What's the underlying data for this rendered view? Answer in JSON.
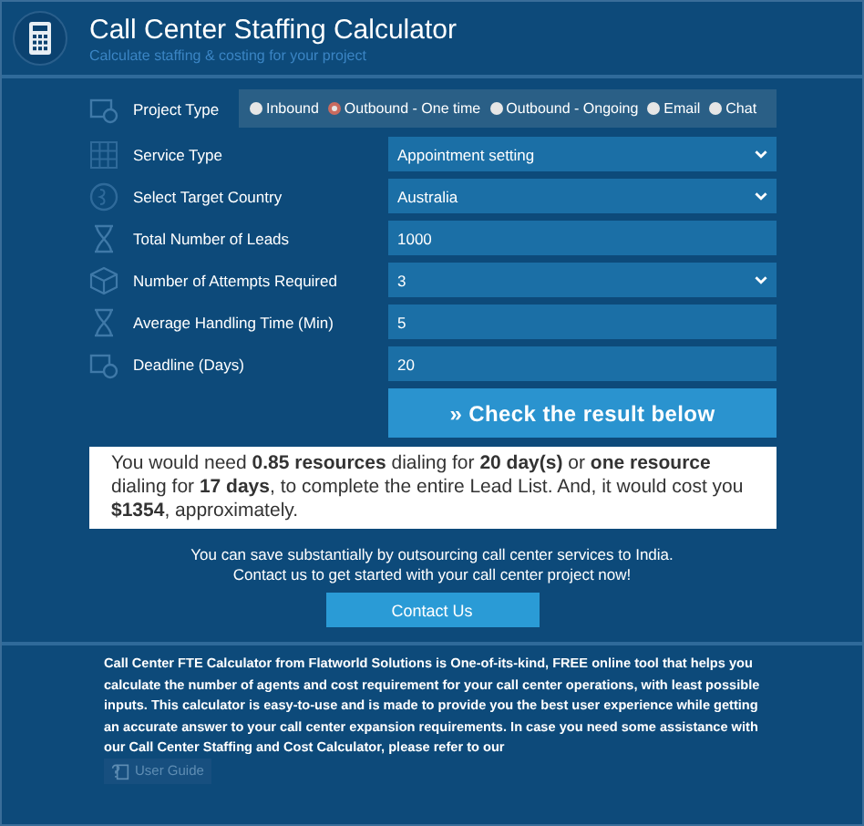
{
  "header": {
    "title": "Call Center Staffing Calculator",
    "subtitle": "Calculate staffing & costing for your project"
  },
  "project_type": {
    "label": "Project Type",
    "options": [
      {
        "label": "Inbound",
        "selected": false
      },
      {
        "label": "Outbound - One time",
        "selected": true
      },
      {
        "label": "Outbound - Ongoing",
        "selected": false
      },
      {
        "label": "Email",
        "selected": false
      },
      {
        "label": "Chat",
        "selected": false
      }
    ]
  },
  "fields": [
    {
      "label": "Service Type",
      "kind": "select",
      "value": "Appointment setting"
    },
    {
      "label": "Select Target Country",
      "kind": "select",
      "value": "Australia"
    },
    {
      "label": "Total Number of Leads",
      "kind": "input",
      "value": "1000"
    },
    {
      "label": "Number of Attempts Required",
      "kind": "select",
      "value": "3"
    },
    {
      "label": "Average Handling Time (Min)",
      "kind": "input",
      "value": "5"
    },
    {
      "label": "Deadline (Days)",
      "kind": "input",
      "value": "20"
    }
  ],
  "submit_button": {
    "icon": "»",
    "label": "Check the result below"
  },
  "result": "You would need **0.85 resources** dialing for **20 day(s)** or **one resource** dialing for **17 days**, to complete the entire Lead List. And, it would cost you **$1354**, approximately.",
  "promo": "You can save substantially by outsourcing call center services to India. Contact us to get started with your call center project now!",
  "contact_button": "Contact Us",
  "footer": {
    "text": "Call Center FTE Calculator from Flatworld Solutions is One-of-its-kind, FREE online tool that helps you calculate the number of agents and cost requirement for your call center operations, with least possible inputs. This calculator is easy-to-use and is made to provide you the best user experience while getting an accurate answer to your call center expansion requirements. In case you need some assistance with our Call Center Staffing and Cost Calculator, please refer to our",
    "guide_button": "User Guide"
  }
}
